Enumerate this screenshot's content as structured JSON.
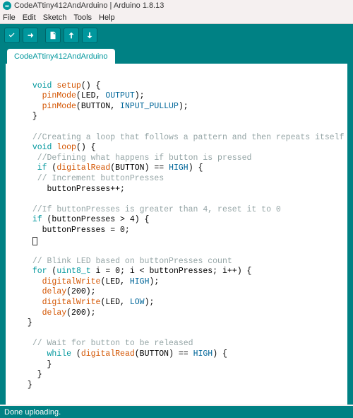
{
  "window": {
    "title": "CodeATtiny412AndArduino | Arduino 1.8.13"
  },
  "menu": [
    "File",
    "Edit",
    "Sketch",
    "Tools",
    "Help"
  ],
  "toolbar": {
    "verify": "verify",
    "upload": "upload",
    "new": "new",
    "open": "open",
    "save": "save"
  },
  "tab": {
    "label": "CodeATtiny412AndArduino"
  },
  "code": {
    "l1a": "void",
    "l1b": " ",
    "l1c": "setup",
    "l1d": "() {",
    "l2a": "pinMode",
    "l2b": "(LED, ",
    "l2c": "OUTPUT",
    "l2d": ");",
    "l3a": "pinMode",
    "l3b": "(BUTTON, ",
    "l3c": "INPUT_PULLUP",
    "l3d": ");",
    "l4": "}",
    "l6": "//Creating a loop that follows a pattern and then repeats itself",
    "l7a": "void",
    "l7b": " ",
    "l7c": "loop",
    "l7d": "() {",
    "l8": "//Defining what happens if button is pressed",
    "l9a": "if",
    "l9b": " (",
    "l9c": "digitalRead",
    "l9d": "(BUTTON) == ",
    "l9e": "HIGH",
    "l9f": ") {",
    "l10": "// Increment buttonPresses",
    "l11": "buttonPresses++;",
    "l13": "//If buttonPresses is greater than 4, reset it to 0",
    "l14a": "if",
    "l14b": " (buttonPresses > 4) {",
    "l15": "buttonPresses = 0;",
    "l16": "}",
    "l18": "// Blink LED based on buttonPresses count",
    "l19a": "for",
    "l19b": " (",
    "l19c": "uint8_t",
    "l19d": " i = 0; i < buttonPresses; i++) {",
    "l20a": "digitalWrite",
    "l20b": "(LED, ",
    "l20c": "HIGH",
    "l20d": ");",
    "l21a": "delay",
    "l21b": "(200);",
    "l22a": "digitalWrite",
    "l22b": "(LED, ",
    "l22c": "LOW",
    "l22d": ");",
    "l23a": "delay",
    "l23b": "(200);",
    "l24": "}",
    "l26": "// Wait for button to be released",
    "l27a": "while",
    "l27b": " (",
    "l27c": "digitalRead",
    "l27d": "(BUTTON) == ",
    "l27e": "HIGH",
    "l27f": ") {",
    "l28": "}",
    "l29": "}",
    "l30": "}"
  },
  "status": {
    "text": "Done uploading."
  }
}
